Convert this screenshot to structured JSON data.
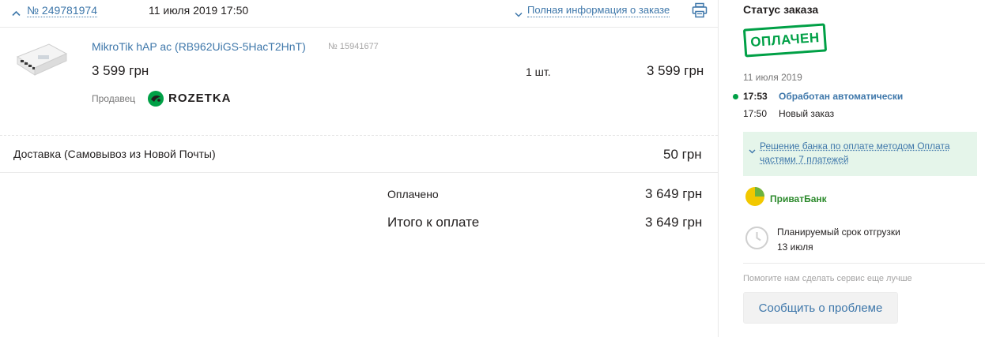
{
  "order": {
    "number": "№ 249781974",
    "date": "11 июля 2019 17:50",
    "full_info_link": "Полная информация о заказе"
  },
  "item": {
    "name": "MikroTik hAP ac (RB962UiGS-5HacT2HnT)",
    "code": "№ 15941677",
    "price": "3 599 грн",
    "quantity": "1 шт.",
    "total": "3 599 грн",
    "seller_label": "Продавец",
    "seller_name": "ROZETKA"
  },
  "delivery": {
    "label": "Доставка (Самовывоз из Новой Почты)",
    "price": "50 грн"
  },
  "totals": {
    "paid_label": "Оплачено",
    "paid_value": "3 649 грн",
    "due_label": "Итого к оплате",
    "due_value": "3 649 грн"
  },
  "status": {
    "title": "Статус заказа",
    "stamp": "ОПЛАЧЕН",
    "date": "11 июля 2019",
    "history": [
      {
        "time": "17:53",
        "text": "Обработан автоматически"
      },
      {
        "time": "17:50",
        "text": "Новый заказ"
      }
    ],
    "bank_decision": "Решение банка по оплате методом Оплата частями 7 платежей",
    "bank_name": "ПриватБанк",
    "shipping_label": "Планируемый срок отгрузки",
    "shipping_date": "13 июля",
    "help_text": "Помогите нам сделать сервис еще лучше",
    "report_button": "Сообщить о проблеме"
  },
  "colors": {
    "link": "#3e77aa",
    "accent_green": "#00a046",
    "bank_box": "#e5f5ea"
  }
}
